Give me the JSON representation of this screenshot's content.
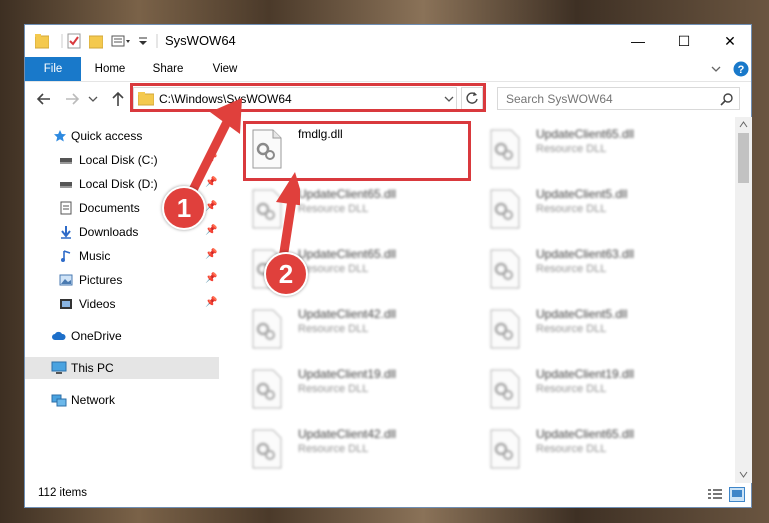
{
  "window": {
    "title": "SysWOW64",
    "minimize_glyph": "—",
    "maximize_glyph": "☐",
    "close_glyph": "✕"
  },
  "ribbon": {
    "tabs": [
      "File",
      "Home",
      "Share",
      "View"
    ]
  },
  "address": {
    "path": "C:\\Windows\\SysWOW64"
  },
  "search": {
    "placeholder": "Search SysWOW64"
  },
  "nav": {
    "items": [
      {
        "label": "Quick access",
        "icon": "star-icon"
      },
      {
        "label": "Local Disk (C:)",
        "icon": "drive-icon"
      },
      {
        "label": "Local Disk (D:)",
        "icon": "drive-icon"
      },
      {
        "label": "Documents",
        "icon": "documents-icon"
      },
      {
        "label": "Downloads",
        "icon": "download-icon"
      },
      {
        "label": "Music",
        "icon": "music-icon"
      },
      {
        "label": "Pictures",
        "icon": "pictures-icon"
      },
      {
        "label": "Videos",
        "icon": "videos-icon"
      },
      {
        "label": "OneDrive",
        "icon": "cloud-icon"
      },
      {
        "label": "This PC",
        "icon": "computer-icon"
      },
      {
        "label": "Network",
        "icon": "network-icon"
      }
    ]
  },
  "files": [
    {
      "name": "fmdlg.dll",
      "type": ""
    },
    {
      "name": "UpdateClient65.dll",
      "type": "Resource DLL"
    },
    {
      "name": "UpdateClient65.dll",
      "type": "Resource DLL"
    },
    {
      "name": "UpdateClient5.dll",
      "type": "Resource DLL"
    },
    {
      "name": "UpdateClient65.dll",
      "type": "Resource DLL"
    },
    {
      "name": "UpdateClient63.dll",
      "type": "Resource DLL"
    },
    {
      "name": "UpdateClient42.dll",
      "type": "Resource DLL"
    },
    {
      "name": "UpdateClient5.dll",
      "type": "Resource DLL"
    },
    {
      "name": "UpdateClient19.dll",
      "type": "Resource DLL"
    },
    {
      "name": "UpdateClient19.dll",
      "type": "Resource DLL"
    },
    {
      "name": "UpdateClient42.dll",
      "type": "Resource DLL"
    },
    {
      "name": "UpdateClient65.dll",
      "type": "Resource DLL"
    }
  ],
  "status": {
    "item_count": "112 items"
  },
  "annotations": {
    "step1": "1",
    "step2": "2",
    "color": "#d9393d"
  }
}
